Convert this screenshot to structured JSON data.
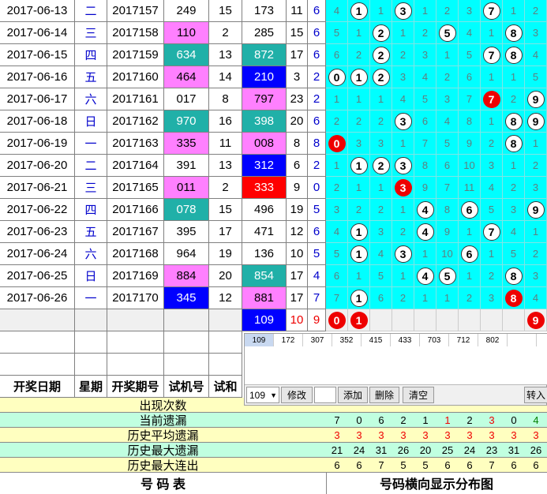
{
  "rows": [
    {
      "date": "2017-06-13",
      "week": "二",
      "issue": "2017157",
      "trial": "249",
      "sum": "15",
      "win": "173",
      "ws": "11",
      "kd": "6"
    },
    {
      "date": "2017-06-14",
      "week": "三",
      "issue": "2017158",
      "trial": "110",
      "sum": "2",
      "win": "285",
      "ws": "15",
      "kd": "6"
    },
    {
      "date": "2017-06-15",
      "week": "四",
      "issue": "2017159",
      "trial": "634",
      "sum": "13",
      "win": "872",
      "ws": "17",
      "kd": "6"
    },
    {
      "date": "2017-06-16",
      "week": "五",
      "issue": "2017160",
      "trial": "464",
      "sum": "14",
      "win": "210",
      "ws": "3",
      "kd": "2"
    },
    {
      "date": "2017-06-17",
      "week": "六",
      "issue": "2017161",
      "trial": "017",
      "sum": "8",
      "win": "797",
      "ws": "23",
      "kd": "2"
    },
    {
      "date": "2017-06-18",
      "week": "日",
      "issue": "2017162",
      "trial": "970",
      "sum": "16",
      "win": "398",
      "ws": "20",
      "kd": "6"
    },
    {
      "date": "2017-06-19",
      "week": "一",
      "issue": "2017163",
      "trial": "335",
      "sum": "11",
      "win": "008",
      "ws": "8",
      "kd": "8"
    },
    {
      "date": "2017-06-20",
      "week": "二",
      "issue": "2017164",
      "trial": "391",
      "sum": "13",
      "win": "312",
      "ws": "6",
      "kd": "2"
    },
    {
      "date": "2017-06-21",
      "week": "三",
      "issue": "2017165",
      "trial": "011",
      "sum": "2",
      "win": "333",
      "ws": "9",
      "kd": "0"
    },
    {
      "date": "2017-06-22",
      "week": "四",
      "issue": "2017166",
      "trial": "078",
      "sum": "15",
      "win": "496",
      "ws": "19",
      "kd": "5"
    },
    {
      "date": "2017-06-23",
      "week": "五",
      "issue": "2017167",
      "trial": "395",
      "sum": "17",
      "win": "471",
      "ws": "12",
      "kd": "6"
    },
    {
      "date": "2017-06-24",
      "week": "六",
      "issue": "2017168",
      "trial": "964",
      "sum": "19",
      "win": "136",
      "ws": "10",
      "kd": "5"
    },
    {
      "date": "2017-06-25",
      "week": "日",
      "issue": "2017169",
      "trial": "884",
      "sum": "20",
      "win": "854",
      "ws": "17",
      "kd": "4"
    },
    {
      "date": "2017-06-26",
      "week": "一",
      "issue": "2017170",
      "trial": "345",
      "sum": "12",
      "win": "881",
      "ws": "17",
      "kd": "7"
    }
  ],
  "dist": [
    [
      "4",
      "1",
      "1",
      "3",
      "1",
      "2",
      "3",
      "7",
      "1",
      "2"
    ],
    [
      "5",
      "1",
      "2",
      "1",
      "2",
      "5",
      "4",
      "1",
      "8",
      "3"
    ],
    [
      "6",
      "2",
      "2",
      "2",
      "3",
      "1",
      "5",
      "7",
      "8",
      "4"
    ],
    [
      "0",
      "1",
      "2",
      "3",
      "4",
      "2",
      "6",
      "1",
      "1",
      "5"
    ],
    [
      "1",
      "1",
      "1",
      "4",
      "5",
      "3",
      "7",
      "7",
      "2",
      "9"
    ],
    [
      "2",
      "2",
      "2",
      "3",
      "6",
      "4",
      "8",
      "1",
      "8",
      "9"
    ],
    [
      "0",
      "3",
      "3",
      "1",
      "7",
      "5",
      "9",
      "2",
      "8",
      "1"
    ],
    [
      "1",
      "1",
      "2",
      "3",
      "8",
      "6",
      "10",
      "3",
      "1",
      "2"
    ],
    [
      "2",
      "1",
      "1",
      "3",
      "9",
      "7",
      "11",
      "4",
      "2",
      "3"
    ],
    [
      "3",
      "2",
      "2",
      "1",
      "4",
      "8",
      "6",
      "5",
      "3",
      "9"
    ],
    [
      "4",
      "1",
      "3",
      "2",
      "4",
      "9",
      "1",
      "7",
      "4",
      "1"
    ],
    [
      "5",
      "1",
      "4",
      "3",
      "1",
      "10",
      "6",
      "1",
      "5",
      "2"
    ],
    [
      "6",
      "1",
      "5",
      "1",
      "4",
      "5",
      "1",
      "2",
      "8",
      "3"
    ],
    [
      "7",
      "1",
      "6",
      "2",
      "1",
      "1",
      "2",
      "3",
      "8",
      "4"
    ]
  ],
  "pending": {
    "win": "109",
    "ws": "10",
    "kd": "9",
    "balls": [
      "0",
      "1",
      "9"
    ]
  },
  "headers": {
    "date": "开奖日期",
    "week": "星期",
    "issue": "开奖期号",
    "trial": "试机号",
    "sum": "试和"
  },
  "stats": [
    {
      "label": "出现次数",
      "values": [
        "",
        "",
        "",
        "",
        "",
        "",
        "",
        "",
        "",
        ""
      ]
    },
    {
      "label": "当前遗漏",
      "values": [
        "7",
        "0",
        "6",
        "2",
        "1",
        "1",
        "2",
        "3",
        "0",
        "4"
      ]
    },
    {
      "label": "历史平均遗漏",
      "values": [
        "3",
        "3",
        "3",
        "3",
        "3",
        "3",
        "3",
        "3",
        "3",
        "3"
      ]
    },
    {
      "label": "历史最大遗漏",
      "values": [
        "21",
        "24",
        "31",
        "26",
        "20",
        "25",
        "24",
        "23",
        "31",
        "26"
      ]
    },
    {
      "label": "历史最大连出",
      "values": [
        "6",
        "6",
        "7",
        "5",
        "5",
        "6",
        "6",
        "7",
        "6",
        "6"
      ]
    }
  ],
  "panel": {
    "tags": [
      "109",
      "172",
      "307",
      "352",
      "415",
      "433",
      "703",
      "712",
      "802",
      ""
    ],
    "select_value": "109",
    "modify": "修改",
    "add": "添加",
    "delete": "删除",
    "clear": "清空",
    "goto": "转入"
  },
  "footer": {
    "left": "号  码  表",
    "right": "号码横向显示分布图"
  },
  "colors": {
    "cyan": "#00ffff",
    "pink": "#ff80ff",
    "teal": "#20b0a8",
    "blue": "#0000ff",
    "red": "#ff0000"
  }
}
